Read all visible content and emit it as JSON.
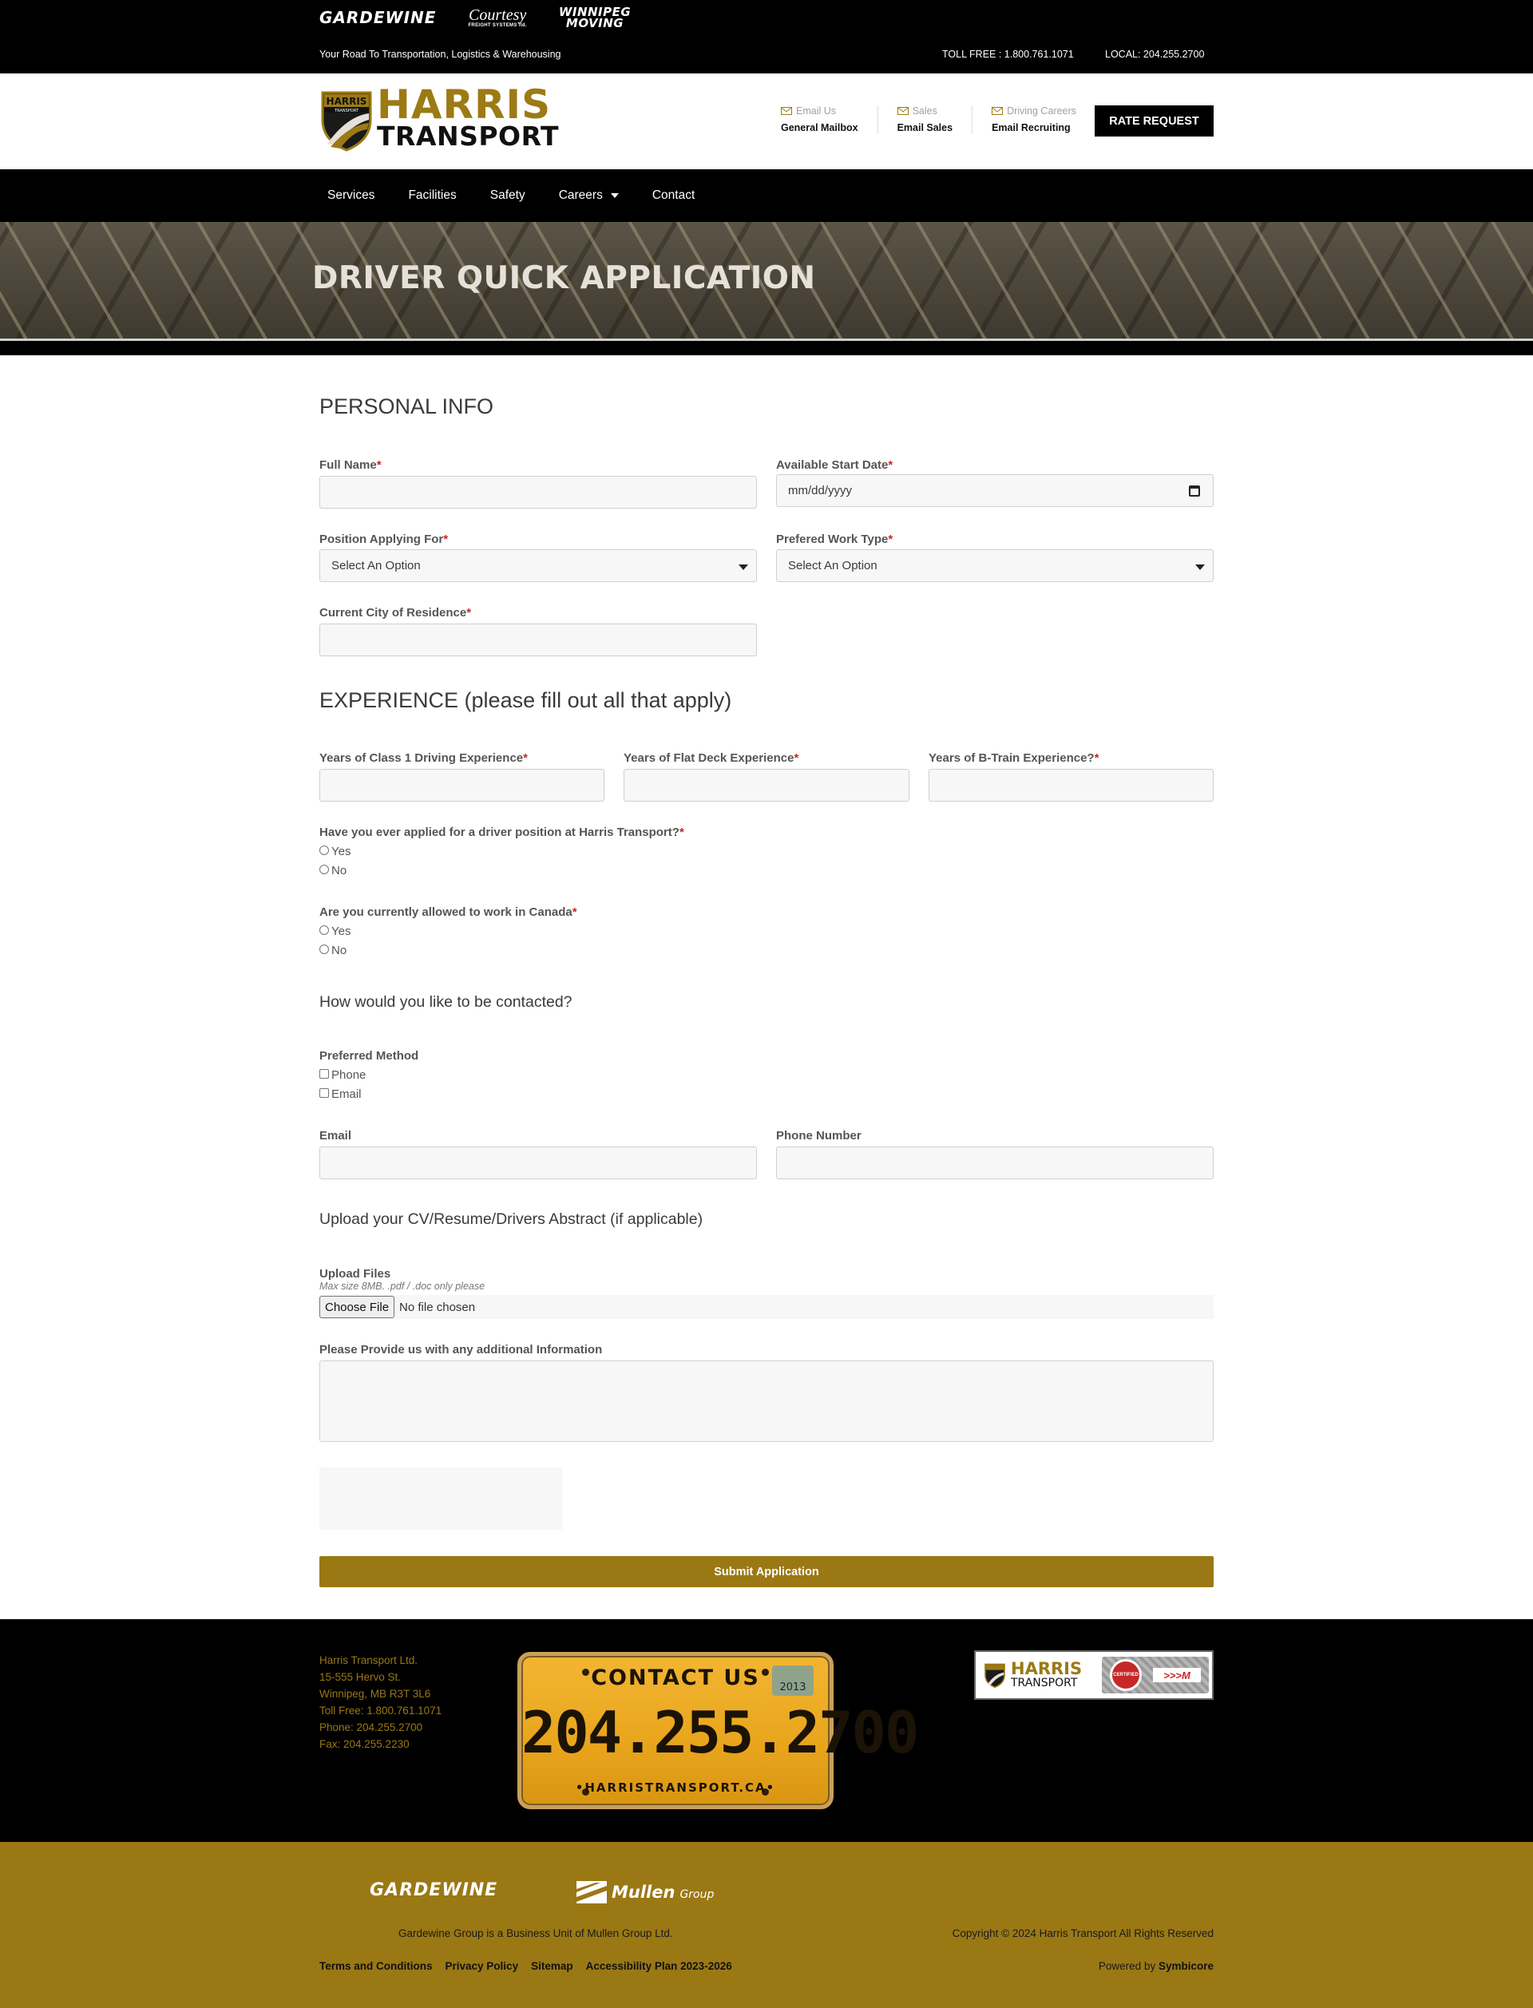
{
  "topbar": {
    "brands": {
      "gardewine": "GARDEWINE",
      "courtesy": "Courtesy",
      "courtesy_sub": "FREIGHT SYSTEMS ltd.",
      "winnipeg_line1": "WINNIPEG",
      "winnipeg_line2": "MOVING"
    },
    "tagline": "Your Road To Transportation, Logistics & Warehousing",
    "toll_free": "TOLL FREE : 1.800.761.1071",
    "local": "LOCAL: 204.255.2700"
  },
  "header": {
    "logo_harris": "HARRIS",
    "logo_transport": "TRANSPORT",
    "logo_shield_text": "HARRIS",
    "logo_shield_sub": "TRANSPORT",
    "contacts": [
      {
        "label": "Email Us",
        "value": "General Mailbox"
      },
      {
        "label": "Sales",
        "value": "Email Sales"
      },
      {
        "label": "Driving Careers",
        "value": "Email Recruiting"
      }
    ],
    "rate_request": "RATE REQUEST"
  },
  "nav": {
    "items": [
      "Services",
      "Facilities",
      "Safety",
      "Careers",
      "Contact"
    ]
  },
  "hero": {
    "title": "DRIVER QUICK APPLICATION"
  },
  "form": {
    "personal_title": "PERSONAL INFO",
    "required_mark": "*",
    "full_name_label": "Full Name",
    "start_date_label": "Available Start Date",
    "start_date_placeholder": "mm/dd/yyyy",
    "position_label": "Position Applying For",
    "position_value": "Select An Option",
    "work_type_label": "Prefered Work Type",
    "work_type_value": "Select An Option",
    "city_label": "Current City of Residence",
    "experience_title": "EXPERIENCE (please fill out all that apply)",
    "class1_label": "Years of Class 1 Driving Experience",
    "flatdeck_label": "Years of Flat Deck Experience",
    "btrain_label": "Years of B-Train Experience?",
    "applied_label": "Have you ever applied for a driver position at Harris Transport?",
    "allowed_label": "Are you currently allowed to work in Canada",
    "yes": "Yes",
    "no": "No",
    "contact_title": "How would you like to be contacted?",
    "preferred_label": "Preferred Method",
    "phone_opt": "Phone",
    "email_opt": "Email",
    "email_label": "Email",
    "phone_label": "Phone Number",
    "upload_title": "Upload your CV/Resume/Drivers Abstract (if applicable)",
    "upload_label": "Upload Files",
    "upload_hint": "Max size 8MB. .pdf / .doc only please",
    "choose_file": "Choose File",
    "no_file": "No file chosen",
    "additional_label": "Please Provide us with any additional Information",
    "submit": "Submit Application"
  },
  "footer": {
    "address_lines": [
      "Harris Transport Ltd.",
      "15-555 Hervo St.",
      "Winnipeg, MB R3T 3L6",
      "Toll Free: 1.800.761.1071",
      "Phone: 204.255.2700",
      "Fax: 204.255.2230"
    ],
    "plate_top": "CONTACT US",
    "plate_number": "204.255.2700",
    "plate_bottom": "•HARRISTRANSPORT.CA•",
    "plate_sticker": "2013",
    "cert_harris": "HARRIS",
    "cert_transport": "TRANSPORT",
    "cert_badge": "CERTIFIED",
    "cert_ftm": ">>>M"
  },
  "bottom": {
    "gardewine": "GARDEWINE",
    "mullen": "Mullen",
    "mullen_group": "Group",
    "unit_text": "Gardewine Group is a Business Unit of Mullen Group Ltd.",
    "copyright": "Copyright © 2024 Harris Transport All Rights Reserved",
    "links": [
      "Terms and Conditions",
      "Privacy Policy",
      "Sitemap",
      "Accessibility Plan 2023-2026"
    ],
    "powered_by": "Powered by",
    "powered_name": "Symbicore"
  },
  "colors": {
    "brand_gold": "#9a7814",
    "required": "#c62828",
    "topbar": "#000000"
  }
}
